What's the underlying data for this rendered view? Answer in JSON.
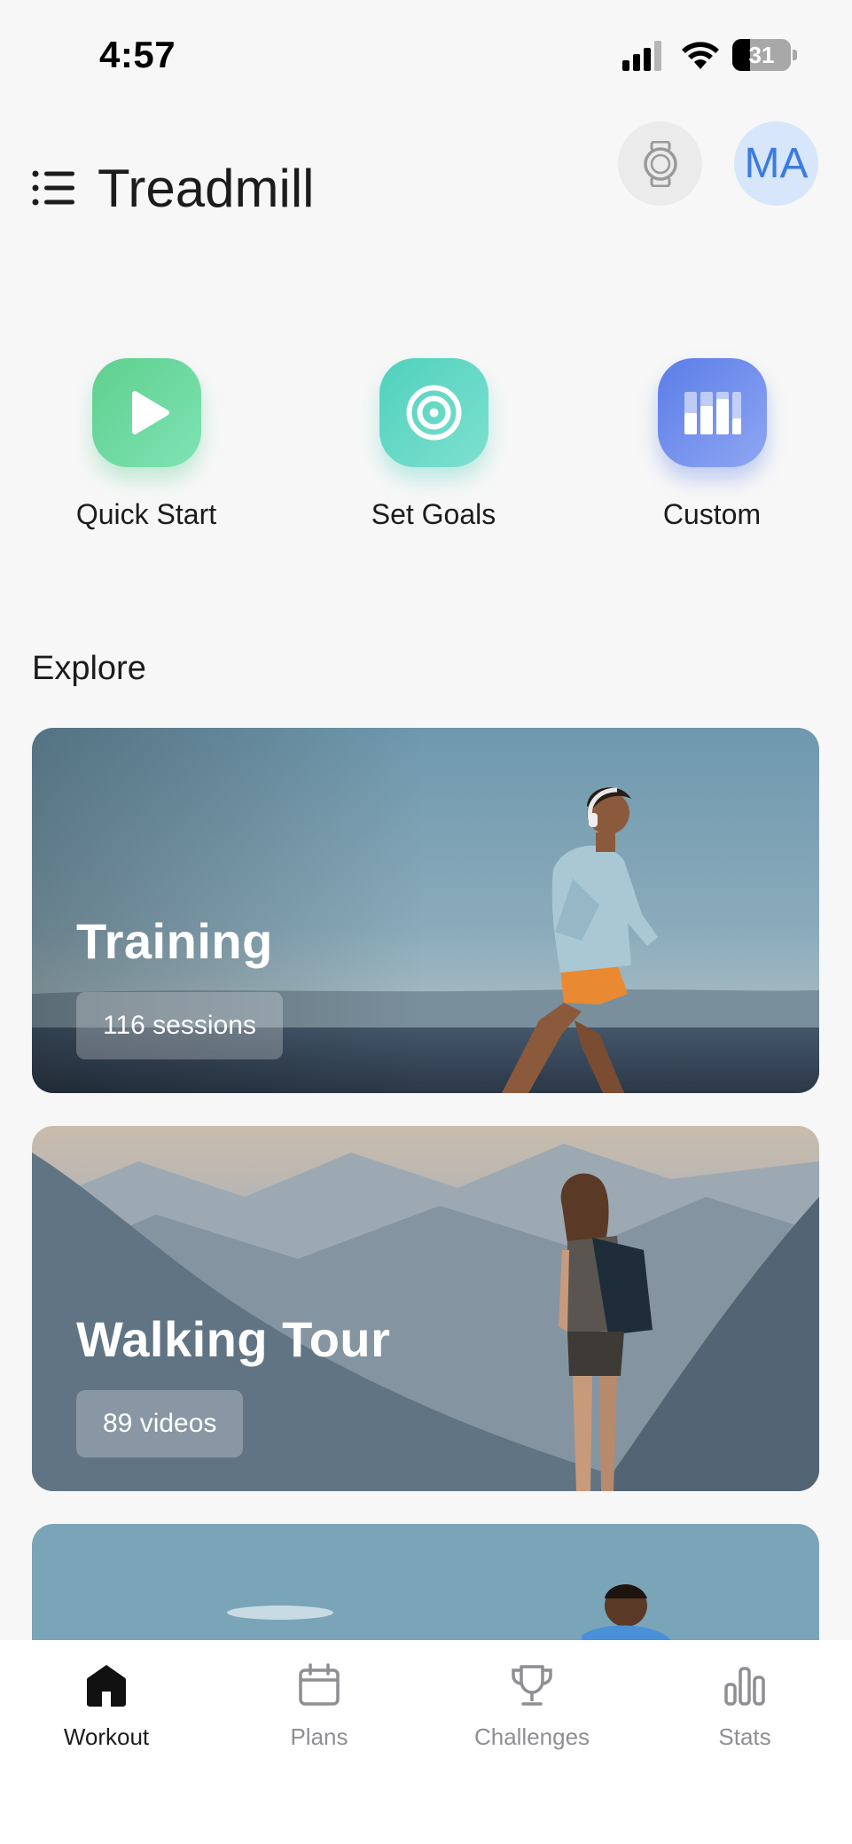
{
  "status_bar": {
    "time": "4:57",
    "battery_level": "31",
    "battery_fraction": 0.31
  },
  "header": {
    "title": "Treadmill",
    "avatar_initials": "MA",
    "menu_icon": "list-menu-icon",
    "watch_icon": "smartwatch-icon"
  },
  "quick_actions": [
    {
      "label": "Quick Start",
      "icon": "play-icon",
      "color": "#6dd9a2"
    },
    {
      "label": "Set Goals",
      "icon": "target-icon",
      "color": "#62d8c6"
    },
    {
      "label": "Custom",
      "icon": "bar-blocks-icon",
      "color": "#7793ee"
    }
  ],
  "explore": {
    "title": "Explore",
    "cards": [
      {
        "title": "Training",
        "badge": "116 sessions"
      },
      {
        "title": "Walking Tour",
        "badge": "89 videos"
      },
      {
        "title": "",
        "badge": ""
      }
    ]
  },
  "bottom_nav": {
    "active": "Workout",
    "items": [
      {
        "label": "Workout",
        "icon": "home-icon"
      },
      {
        "label": "Plans",
        "icon": "calendar-icon"
      },
      {
        "label": "Challenges",
        "icon": "trophy-icon"
      },
      {
        "label": "Stats",
        "icon": "stats-bars-icon"
      }
    ]
  },
  "colors": {
    "background": "#f7f7f7",
    "avatar_bg": "#d7e6fb",
    "avatar_text": "#3b7be0",
    "nav_active": "#1c1c1e",
    "nav_inactive": "#8e8e93"
  }
}
